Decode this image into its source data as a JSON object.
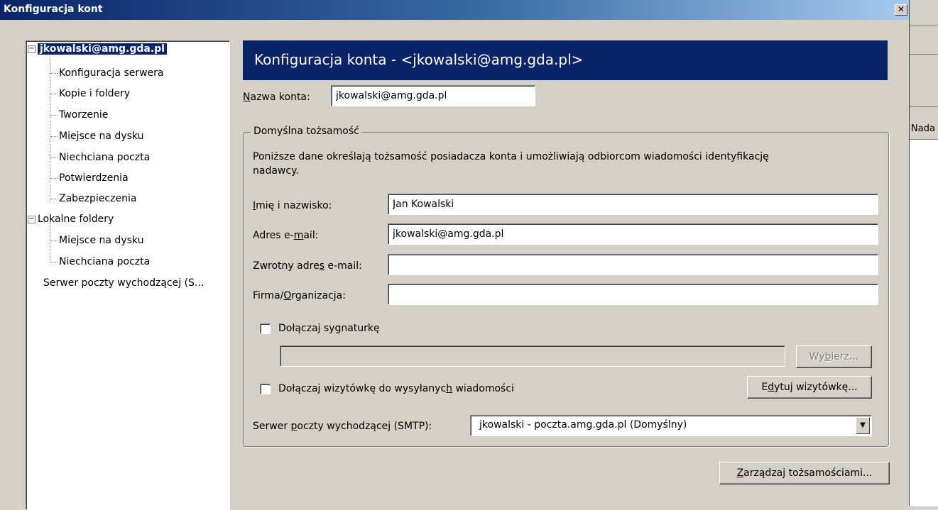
{
  "window": {
    "title": "Konfiguracja kont",
    "close_glyph": "✕"
  },
  "background_window": {
    "fragment": "Nada"
  },
  "tree": {
    "account": {
      "label": "jkowalski@amg.gda.pl",
      "toggle": "−"
    },
    "account_children": [
      "Konfiguracja serwera",
      "Kopie i foldery",
      "Tworzenie",
      "Miejsce na dysku",
      "Niechciana poczta",
      "Potwierdzenia",
      "Zabezpieczenia"
    ],
    "local": {
      "label": "Lokalne foldery",
      "toggle": "−"
    },
    "local_children": [
      "Miejsce na dysku",
      "Niechciana poczta"
    ],
    "smtp": "Serwer poczty wychodzącej (S..."
  },
  "header": {
    "title": "Konfiguracja konta - <jkowalski@amg.gda.pl>"
  },
  "account_name": {
    "label_u": "N",
    "label_rest": "azwa konta:",
    "value": "jkowalski@amg.gda.pl"
  },
  "identity": {
    "group_title": "Domyślna tożsamość",
    "description_line1": "Poniższe dane określają tożsamość posiadacza konta i umożliwiają odbiorcom wiadomości identyfikację",
    "description_line2": "nadawcy.",
    "name": {
      "label_u": "I",
      "label_rest": "mię i nazwisko:",
      "value": "Jan Kowalski"
    },
    "email": {
      "label_pre": "Adres e-",
      "label_u": "m",
      "label_rest": "ail:",
      "value": "jkowalski@amg.gda.pl"
    },
    "reply": {
      "label_pre": "Zwrotny adre",
      "label_u": "s",
      "label_rest": " e-mail:",
      "value": ""
    },
    "org": {
      "label_pre": "Firma/",
      "label_u": "O",
      "label_rest": "rganizacja:",
      "value": ""
    },
    "signature": {
      "label_pre": "Dołączaj sy",
      "label_u": "g",
      "label_rest": "naturkę",
      "path": ""
    },
    "choose_button": {
      "pre": "Wy",
      "u": "b",
      "rest": "ierz..."
    },
    "vcard": {
      "label_pre": "Dołączaj wizytówkę do wysyłanyc",
      "label_u": "h",
      "label_rest": " wiadomości"
    },
    "edit_vcard_button": {
      "pre": "E",
      "u": "d",
      "rest": "ytuj wizytówkę..."
    },
    "smtp": {
      "label_pre": "Serwer ",
      "label_u": "p",
      "label_rest": "oczty wychodzącej (SMTP):",
      "value": "jkowalski - poczta.amg.gda.pl (Domyślny)",
      "arrow": "▼"
    }
  },
  "manage_button": {
    "u": "Z",
    "rest": "arządzaj tożsamościami..."
  }
}
